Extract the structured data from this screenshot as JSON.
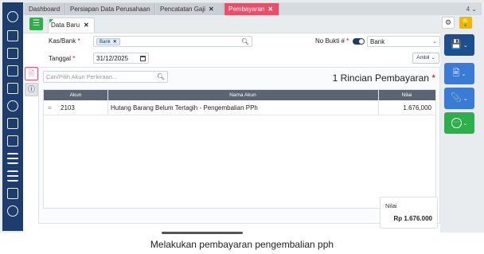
{
  "sidebar": {
    "icons": [
      "gear-icon",
      "building-icon",
      "office-icon",
      "calculator-icon",
      "warehouse-icon",
      "box-icon",
      "cart-icon",
      "truck-icon",
      "chart-icon",
      "factory-icon",
      "id-card-icon",
      "badge-icon",
      "report-icon"
    ]
  },
  "tabs": [
    {
      "label": "Dashboard",
      "closable": false
    },
    {
      "label": "Persiapan Data Perusahaan",
      "closable": false
    },
    {
      "label": "Pencatatan Gaji",
      "closable": true
    },
    {
      "label": "Pembayaran",
      "closable": true,
      "active": true
    }
  ],
  "tabs_more": "4 ⌄",
  "toolbar": {
    "list_icon": "☰",
    "form_tab_label": "Data Baru",
    "form_tab_close": "✕",
    "gear_glyph": "⚙",
    "bulb_glyph": "💡"
  },
  "form": {
    "kas_label": "Kas/Bank",
    "kas_value": "Bank",
    "tanggal_label": "Tanggal",
    "tanggal_value": "31/12/2025",
    "nobukti_label": "No Bukti #",
    "bank_select_value": "Bank",
    "ambil_label": "Ambil",
    "required_mark": "*"
  },
  "detail": {
    "search_placeholder": "Cari/Pilih Akun Perkiraan...",
    "rincian_title": "1 Rincian Pembayaran",
    "columns": [
      "Akun",
      "Nama Akun",
      "Nilai"
    ],
    "rows": [
      {
        "handle": "≡",
        "akun": "2103",
        "nama": "Hutang Barang Belum Tertagih - Pengembalian PPh",
        "nilai": "1.676,000"
      }
    ]
  },
  "summary": {
    "nilai_label": "Nilai",
    "nilai_value": "Rp 1.676.000"
  },
  "actions": {
    "save_glyph": "💾",
    "print_glyph": "🖹",
    "attach_glyph": "📎",
    "more_glyph": "···",
    "chevron": "⌄"
  },
  "caption": "Melakukan pembayaran pengembalian pph",
  "colors": {
    "sidebar": "#1c3d6e",
    "active_tab": "#e8506a",
    "green": "#2bb04a",
    "blue": "#3b7bd8"
  }
}
